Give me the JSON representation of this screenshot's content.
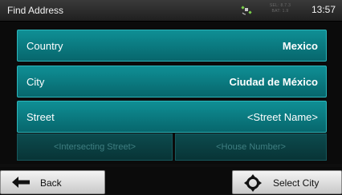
{
  "header": {
    "title": "Find Address",
    "gps_icon": "satellite-gps-icon",
    "status_line1": "SEL: 8.7.3",
    "status_line2": "BAT: 1.9",
    "time": "13:57"
  },
  "fields": {
    "country": {
      "label": "Country",
      "value": "Mexico"
    },
    "city": {
      "label": "City",
      "value": "Ciudad de México"
    },
    "street": {
      "label": "Street",
      "value": "<Street Name>"
    },
    "intersecting_street": {
      "placeholder": "<Intersecting Street>"
    },
    "house_number": {
      "placeholder": "<House Number>"
    }
  },
  "toolbar": {
    "back_label": "Back",
    "back_icon": "arrow-left-icon",
    "select_city_label": "Select City",
    "select_city_icon": "crosshair-target-icon"
  },
  "colors": {
    "row_active": "#0b7d83",
    "row_border": "#2cb6bb",
    "row_disabled": "#0a4043",
    "button_face": "#e3e3e3"
  }
}
